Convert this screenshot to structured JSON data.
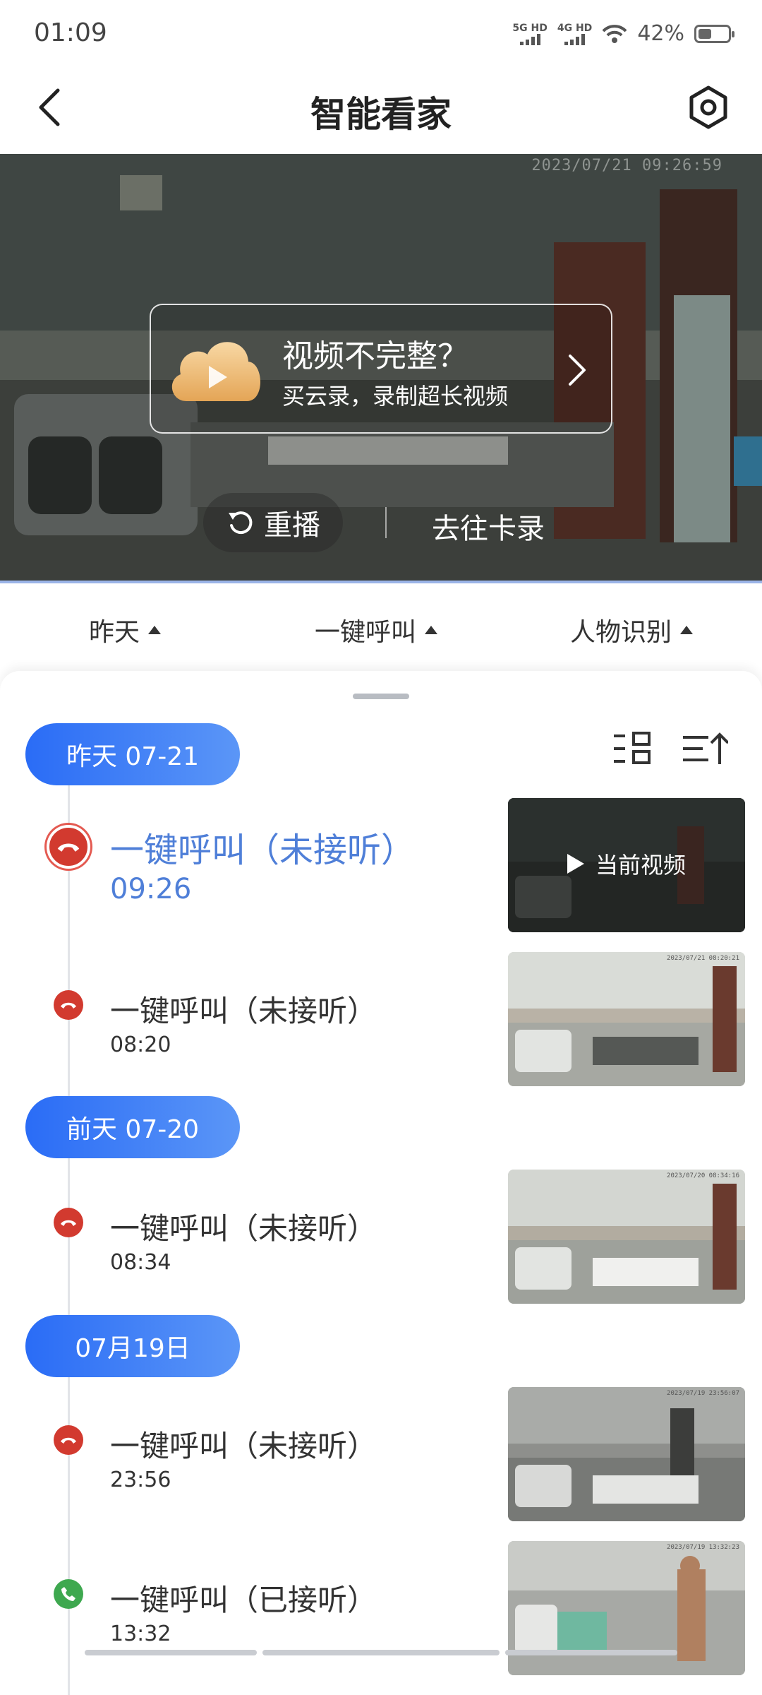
{
  "status": {
    "time": "01:09",
    "net1": "5G HD",
    "net2": "4G HD",
    "battery": "42%"
  },
  "header": {
    "title": "智能看家",
    "back_icon": "chevron-left-icon",
    "settings_icon": "gear-icon"
  },
  "video": {
    "timestamp": "2023/07/21 09:26:59",
    "banner": {
      "title": "视频不完整？",
      "subtitle": "买云录，录制超长视频"
    },
    "replay_label": "重播",
    "card_record_label": "去往卡录"
  },
  "filters": [
    {
      "label": "昨天"
    },
    {
      "label": "一键呼叫"
    },
    {
      "label": "人物识别"
    }
  ],
  "groups": [
    {
      "date": "昨天 07-21"
    },
    {
      "date": "前天 07-20"
    },
    {
      "date": "07月19日"
    }
  ],
  "events": [
    {
      "title": "一键呼叫（未接听）",
      "time": "09:26",
      "status": "missed",
      "current": true,
      "thumb_label": "当前视频"
    },
    {
      "title": "一键呼叫（未接听）",
      "time": "08:20",
      "status": "missed",
      "thumb_ts": "2023/07/21 08:20:21"
    },
    {
      "title": "一键呼叫（未接听）",
      "time": "08:34",
      "status": "missed",
      "thumb_ts": "2023/07/20 08:34:16"
    },
    {
      "title": "一键呼叫（未接听）",
      "time": "23:56",
      "status": "missed",
      "thumb_ts": "2023/07/19 23:56:07"
    },
    {
      "title": "一键呼叫（已接听）",
      "time": "13:32",
      "status": "answered",
      "thumb_ts": "2023/07/19 13:32:23"
    }
  ],
  "colors": {
    "accent": "#2a6cf6",
    "missed": "#d23a2f",
    "answered": "#3ea84f",
    "active_text": "#4f7fd8"
  }
}
